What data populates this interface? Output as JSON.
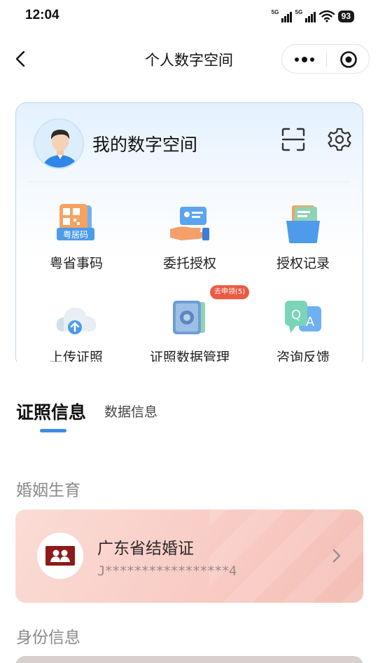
{
  "status_bar": {
    "time": "12:04",
    "signal1_tag": "5G",
    "signal2_tag": "5G",
    "battery": "93"
  },
  "nav": {
    "title": "个人数字空间"
  },
  "card": {
    "title": "我的数字空间",
    "items": [
      {
        "label": "粤省事码",
        "icon": "qr-code-icon",
        "sub_label": "粤居码"
      },
      {
        "label": "委托授权",
        "icon": "hand-card-icon"
      },
      {
        "label": "授权记录",
        "icon": "folder-doc-icon"
      },
      {
        "label": "上传证照",
        "icon": "cloud-upload-icon"
      },
      {
        "label": "证照数据管理",
        "icon": "safe-icon"
      },
      {
        "label": "咨询反馈",
        "icon": "qa-chat-icon"
      }
    ],
    "badge": "去申领(5)"
  },
  "tabs": [
    {
      "label": "证照信息",
      "active": true
    },
    {
      "label": "数据信息",
      "active": false
    }
  ],
  "sections": {
    "marriage": "婚姻生育",
    "identity": "身份信息"
  },
  "certificate": {
    "name": "广东省结婚证",
    "number": "J*****************4"
  },
  "colors": {
    "accent": "#3e8be7",
    "badge": "#ea5b43",
    "cert_icon": "#8e1a1a"
  }
}
